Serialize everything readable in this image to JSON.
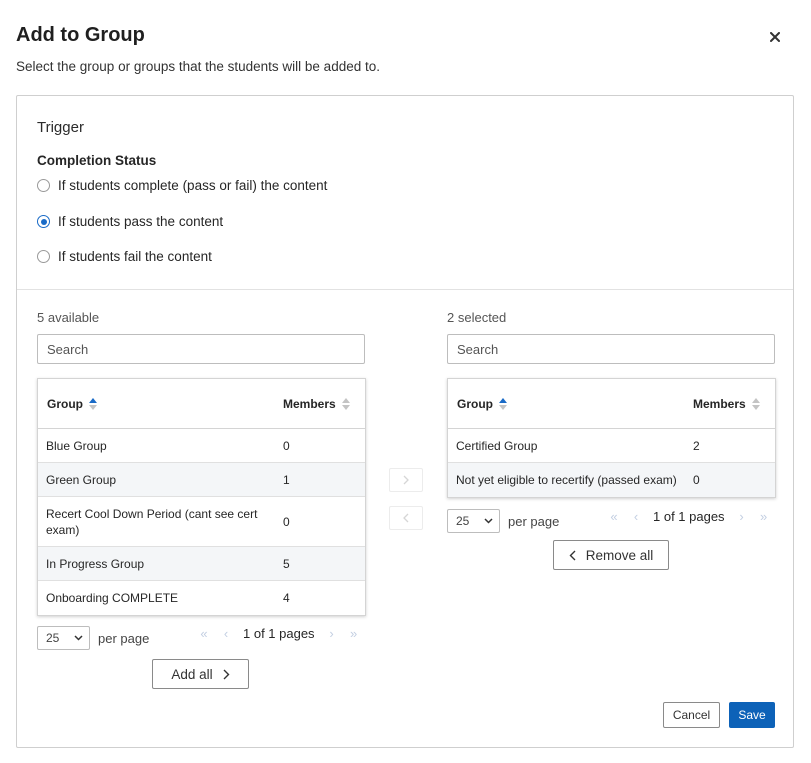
{
  "dialog": {
    "title": "Add to Group",
    "subtitle": "Select the group or groups that the students will be added to."
  },
  "trigger": {
    "title": "Trigger",
    "completion_label": "Completion Status",
    "options": [
      {
        "label": "If students complete (pass or fail) the content",
        "checked": false
      },
      {
        "label": "If students pass the content",
        "checked": true
      },
      {
        "label": "If students fail the content",
        "checked": false
      }
    ]
  },
  "available": {
    "count_label": "5 available",
    "search_placeholder": "Search",
    "headers": {
      "group": "Group",
      "members": "Members"
    },
    "rows": [
      {
        "group": "Blue Group",
        "members": "0"
      },
      {
        "group": "Green Group",
        "members": "1"
      },
      {
        "group": "Recert Cool Down Period (cant see cert exam)",
        "members": "0"
      },
      {
        "group": "In Progress Group",
        "members": "5"
      },
      {
        "group": "Onboarding COMPLETE",
        "members": "4"
      }
    ],
    "per_page_value": "25",
    "per_page_label": "per page",
    "page_info": "1 of 1 pages",
    "add_all_label": "Add all"
  },
  "selected": {
    "count_label": "2 selected",
    "search_placeholder": "Search",
    "headers": {
      "group": "Group",
      "members": "Members"
    },
    "rows": [
      {
        "group": "Certified Group",
        "members": "2"
      },
      {
        "group": "Not yet eligible to recertify (passed exam)",
        "members": "0"
      }
    ],
    "per_page_value": "25",
    "per_page_label": "per page",
    "page_info": "1 of 1 pages",
    "remove_all_label": "Remove all"
  },
  "footer": {
    "cancel_label": "Cancel",
    "save_label": "Save"
  },
  "colors": {
    "accent": "#1a6bc7",
    "primary_button": "#0d62b8"
  }
}
